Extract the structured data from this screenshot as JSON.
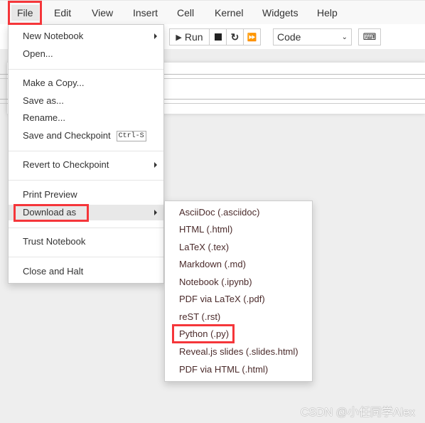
{
  "menubar": {
    "items": [
      "File",
      "Edit",
      "View",
      "Insert",
      "Cell",
      "Kernel",
      "Widgets",
      "Help"
    ]
  },
  "toolbar": {
    "run_label": "Run",
    "cell_type": "Code"
  },
  "file_menu": {
    "items": [
      {
        "label": "New Notebook",
        "submenu": true
      },
      {
        "label": "Open..."
      },
      {
        "label": "Make a Copy..."
      },
      {
        "label": "Save as..."
      },
      {
        "label": "Rename..."
      },
      {
        "label": "Save and Checkpoint",
        "shortcut": "Ctrl-S"
      },
      {
        "label": "Revert to Checkpoint",
        "submenu": true
      },
      {
        "label": "Print Preview"
      },
      {
        "label": "Download as",
        "submenu": true,
        "active": true
      },
      {
        "label": "Trust Notebook"
      },
      {
        "label": "Close and Halt"
      }
    ]
  },
  "download_menu": {
    "items": [
      "AsciiDoc (.asciidoc)",
      "HTML (.html)",
      "LaTeX (.tex)",
      "Markdown (.md)",
      "Notebook (.ipynb)",
      "PDF via LaTeX (.pdf)",
      "reST (.rst)",
      "Python (.py)",
      "Reveal.js slides (.slides.html)",
      "PDF via HTML (.html)"
    ]
  },
  "highlight_color": "#f5363a",
  "watermark": "CSDN @小任同学Alex"
}
